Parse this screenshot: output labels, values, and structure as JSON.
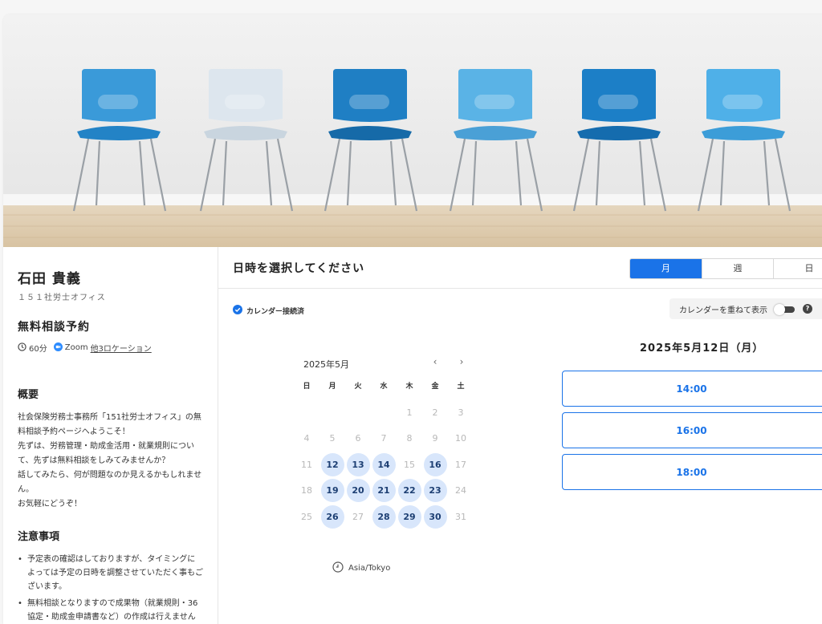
{
  "owner": {
    "name": "石田 貴義",
    "org": "１５１社労士オフィス"
  },
  "event": {
    "title": "無料相談予約",
    "duration": "60分",
    "location": "Zoom",
    "other_locations": "他3ロケーション"
  },
  "overview": {
    "title": "概要",
    "paragraphs": [
      "社会保険労務士事務所「151社労士オフィス」の無料相談予約ページへようこそ！",
      "先ずは、労務管理・助成金活用・就業規則について、先ずは無料相談をしみてみませんか？",
      "話してみたら、何が問題なのか見えるかもしれません。",
      "お気軽にどうぞ！"
    ]
  },
  "notes": {
    "title": "注意事項",
    "items": [
      "予定表の確認はしておりますが、タイミングによっては予定の日時を調整させていただく事もございます。",
      "無料相談となりますので成果物（就業規則・36協定・助成金申請書など）の作成は行えませんのでご注意ください。"
    ]
  },
  "main": {
    "title": "日時を選択してください",
    "view_tabs": [
      "月",
      "週",
      "日"
    ],
    "active_tab": "月",
    "calendar_connected": "カレンダー接続済",
    "overlay_label": "カレンダーを重ねて表示",
    "overlay_on": false,
    "help_glyph": "?"
  },
  "calendar": {
    "month_label": "2025年5月",
    "prev": "‹",
    "next": "›",
    "weekdays": [
      "日",
      "月",
      "火",
      "水",
      "木",
      "金",
      "土"
    ],
    "lead_blanks": 4,
    "days_in_month": 31,
    "available_days": [
      12,
      13,
      14,
      16,
      19,
      20,
      21,
      22,
      23,
      26,
      28,
      29,
      30
    ],
    "timezone": "Asia/Tokyo"
  },
  "slots": {
    "selected_date": "2025年5月12日（月）",
    "times": [
      "14:00",
      "16:00",
      "18:00"
    ]
  },
  "colors": {
    "accent": "#1a73e8",
    "available_bg": "#d8e6fb"
  }
}
